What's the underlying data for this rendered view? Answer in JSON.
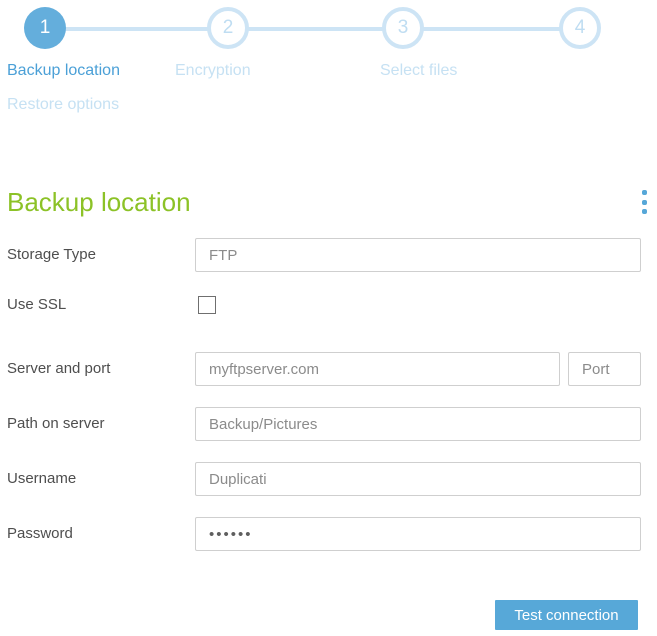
{
  "wizard": {
    "steps": [
      {
        "number": "1",
        "label": "Backup location",
        "state": "active"
      },
      {
        "number": "2",
        "label": "Encryption",
        "state": "inactive"
      },
      {
        "number": "3",
        "label": "Select files",
        "state": "inactive"
      },
      {
        "number": "4",
        "label": "Restore options",
        "state": "inactive"
      }
    ]
  },
  "page": {
    "title": "Backup location"
  },
  "form": {
    "storage_type": {
      "label": "Storage Type",
      "value": "FTP"
    },
    "use_ssl": {
      "label": "Use SSL",
      "checked": false
    },
    "server": {
      "label": "Server and port",
      "value": "myftpserver.com",
      "port_placeholder": "Port"
    },
    "path": {
      "label": "Path on server",
      "value": "Backup/Pictures"
    },
    "username": {
      "label": "Username",
      "value": "Duplicati"
    },
    "password": {
      "label": "Password",
      "masked_value": "••••••"
    }
  },
  "actions": {
    "test_connection_label": "Test connection"
  },
  "colors": {
    "accent_blue": "#57a8d8",
    "active_circle_blue": "#64aedc",
    "light_blue": "#cde4f5",
    "active_label_blue": "#4ba0d7",
    "inactive_label_blue": "#c6e1f3",
    "heading_green": "#8cc227",
    "label_gray": "#4e4e4e",
    "value_gray": "#8b8b8b",
    "input_border_gray": "#cfcfcf"
  }
}
